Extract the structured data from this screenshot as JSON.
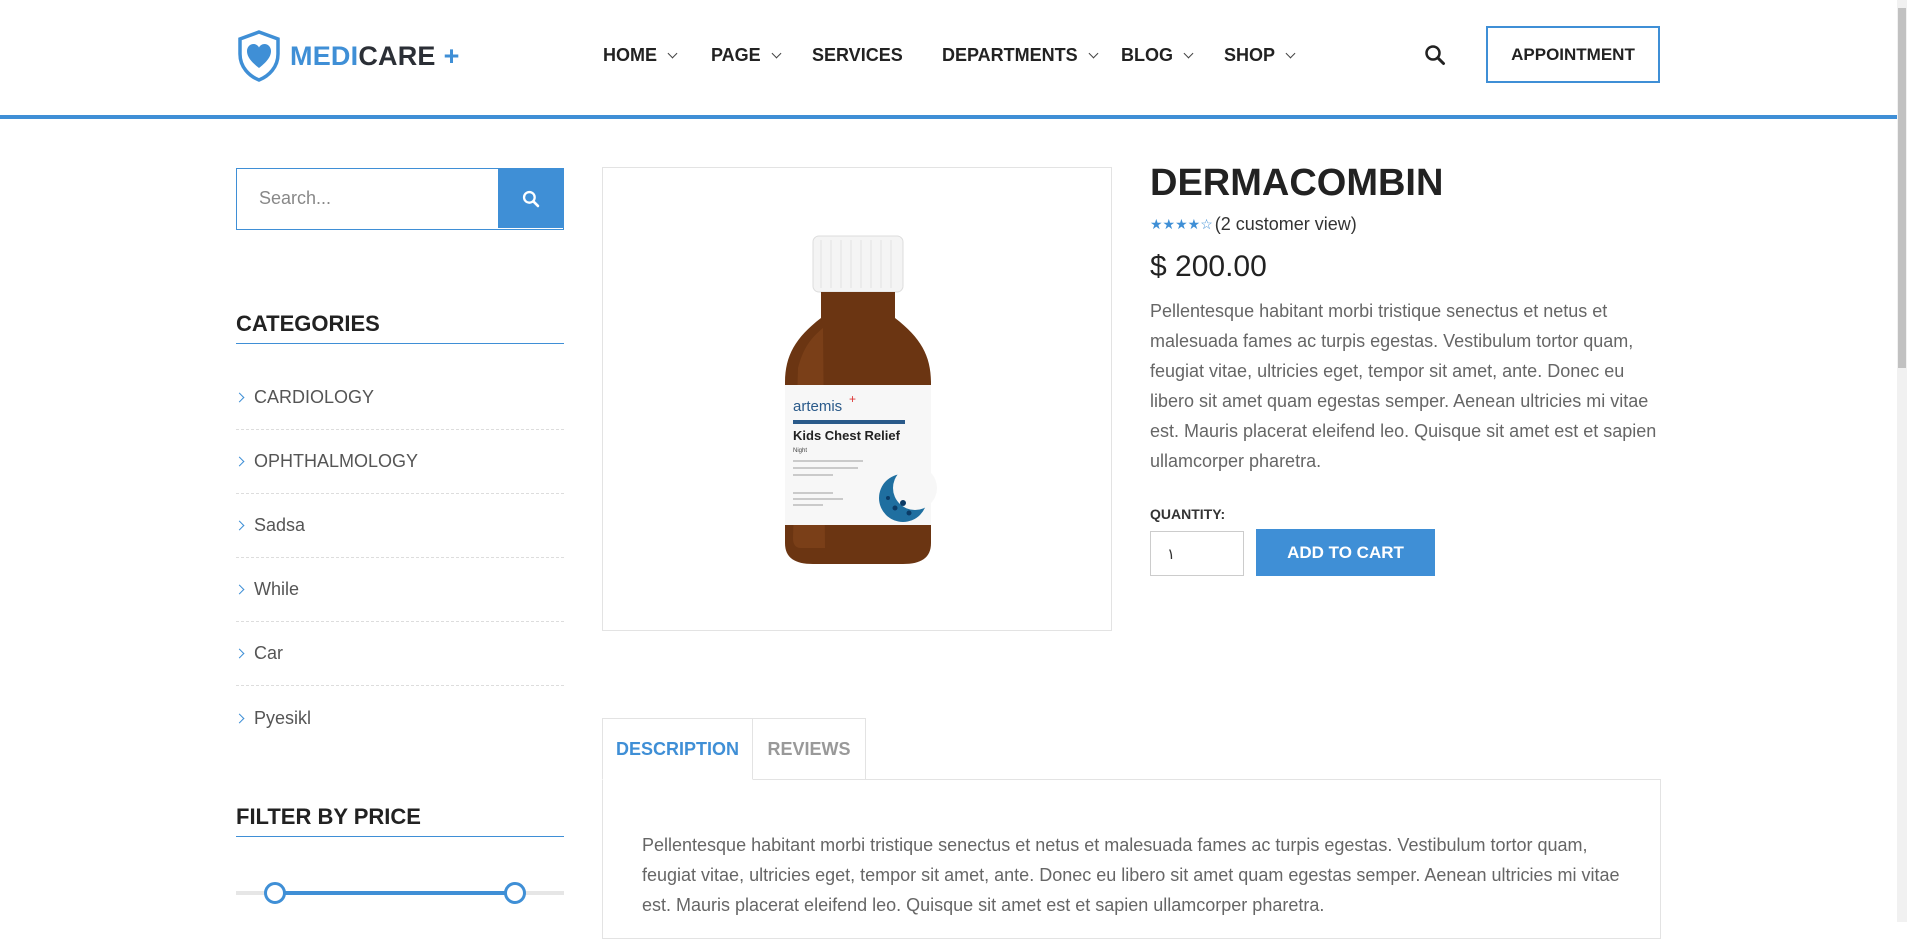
{
  "header": {
    "logo": {
      "part1": "MEDI",
      "part2": "CARE",
      "plus": "+"
    },
    "nav": [
      {
        "label": "HOME",
        "dropdown": true
      },
      {
        "label": "PAGE",
        "dropdown": true
      },
      {
        "label": "SERVICES",
        "dropdown": false
      },
      {
        "label": "DEPARTMENTS",
        "dropdown": true
      },
      {
        "label": "BLOG",
        "dropdown": true
      },
      {
        "label": "SHOP",
        "dropdown": true
      }
    ],
    "appointment_label": "APPOINTMENT"
  },
  "sidebar": {
    "search_placeholder": "Search...",
    "categories_title": "CATEGORIES",
    "categories": [
      "CARDIOLOGY",
      "OPHTHALMOLOGY",
      "Sadsa",
      "While",
      "Car",
      "Pyesikl"
    ],
    "filter_title": "FILTER BY PRICE",
    "price_range_low_fraction": 0.12,
    "price_range_high_fraction": 0.85
  },
  "product": {
    "title": "DERMACOMBIN",
    "rating_stars": 4,
    "rating_max": 5,
    "rating_text": "(2 customer view)",
    "price": "$ 200.00",
    "description": "Pellentesque habitant morbi tristique senectus et netus et malesuada fames ac turpis egestas. Vestibulum tortor quam, feugiat vitae, ultricies eget, tempor sit amet, ante. Donec eu libero sit amet quam egestas semper. Aenean ultricies mi vitae est. Mauris placerat eleifend leo. Quisque sit amet est et sapien ullamcorper pharetra.",
    "quantity_label": "QUANTITY:",
    "quantity_value": "١",
    "add_to_cart_label": "ADD TO CART",
    "image": {
      "brand": "artemis",
      "name": "Kids Chest Relief",
      "sub": "Night"
    }
  },
  "tabs": {
    "items": [
      "DESCRIPTION",
      "REVIEWS"
    ],
    "active": "DESCRIPTION",
    "description_text": "Pellentesque habitant morbi tristique senectus et netus et malesuada fames ac turpis egestas. Vestibulum tortor quam, feugiat vitae, ultricies eget, tempor sit amet, ante. Donec eu libero sit amet quam egestas semper. Aenean ultricies mi vitae est. Mauris placerat eleifend leo. Quisque sit amet est et sapien ullamcorper pharetra."
  },
  "colors": {
    "accent": "#3f8fd6",
    "dark": "#2b2f36"
  }
}
